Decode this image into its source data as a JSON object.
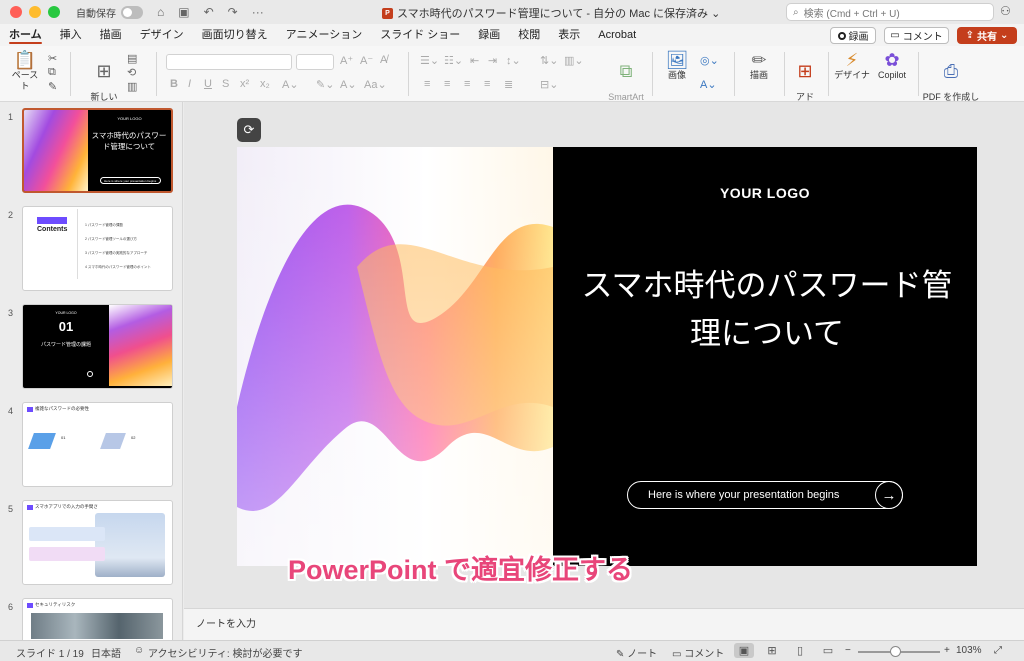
{
  "titlebar": {
    "autosave_label": "自動保存",
    "doc_title": "スマホ時代のパスワード管理について - 自分の Mac に保存済み ⌄",
    "search_placeholder": "検索 (Cmd + Ctrl + U)"
  },
  "tabs": [
    "ホーム",
    "挿入",
    "描画",
    "デザイン",
    "画面切り替え",
    "アニメーション",
    "スライド ショー",
    "録画",
    "校閲",
    "表示",
    "Acrobat"
  ],
  "actions": {
    "record": "録画",
    "comment": "コメント",
    "share": "共有"
  },
  "ribbon": {
    "paste": "ペースト",
    "new_slide": "新しい\nスライド",
    "smartart": "SmartArt\nに変換",
    "image": "画像",
    "draw": "描画",
    "addin": "アド\nイン",
    "designer": "デザイナ",
    "copilot": "Copilot",
    "pdf": "PDF を作成し\nてリンクを共有"
  },
  "thumbnails": [
    {
      "num": "1",
      "logo": "YOUR LOGO",
      "title": "スマホ時代のパスワード管理について",
      "pill": "Here is where your presentation begins"
    },
    {
      "num": "2",
      "title": "Contents",
      "items": [
        "1 パスワード管理の課題",
        "2 パスワード管理ツールの選び方",
        "3 パスワード管理の実践的なアプローチ",
        "4 スマホ時代のパスワード管理のポイント"
      ]
    },
    {
      "num": "3",
      "logo": "YOUR LOGO",
      "number": "01",
      "title": "パスワード管理の課題"
    },
    {
      "num": "4",
      "title": "複雑なパスワードの必要性",
      "n1": "01",
      "n2": "02"
    },
    {
      "num": "5",
      "title": "スマホアプリでの入力の手間さ"
    },
    {
      "num": "6",
      "title": "セキュリティリスク"
    }
  ],
  "slide": {
    "logo": "YOUR LOGO",
    "title": "スマホ時代のパスワード管理について",
    "pill": "Here is where your presentation begins"
  },
  "overlay_caption": "PowerPoint で適宜修正する",
  "notes_placeholder": "ノートを入力",
  "status": {
    "slide_count": "スライド 1 / 19",
    "language": "日本語",
    "accessibility": "アクセシビリティ: 検討が必要です",
    "notes": "ノート",
    "comments": "コメント",
    "zoom": "103%"
  },
  "colors": {
    "brand": "#c43e1c",
    "caption": "#e8467a",
    "accent_purple": "#6d4cff"
  }
}
